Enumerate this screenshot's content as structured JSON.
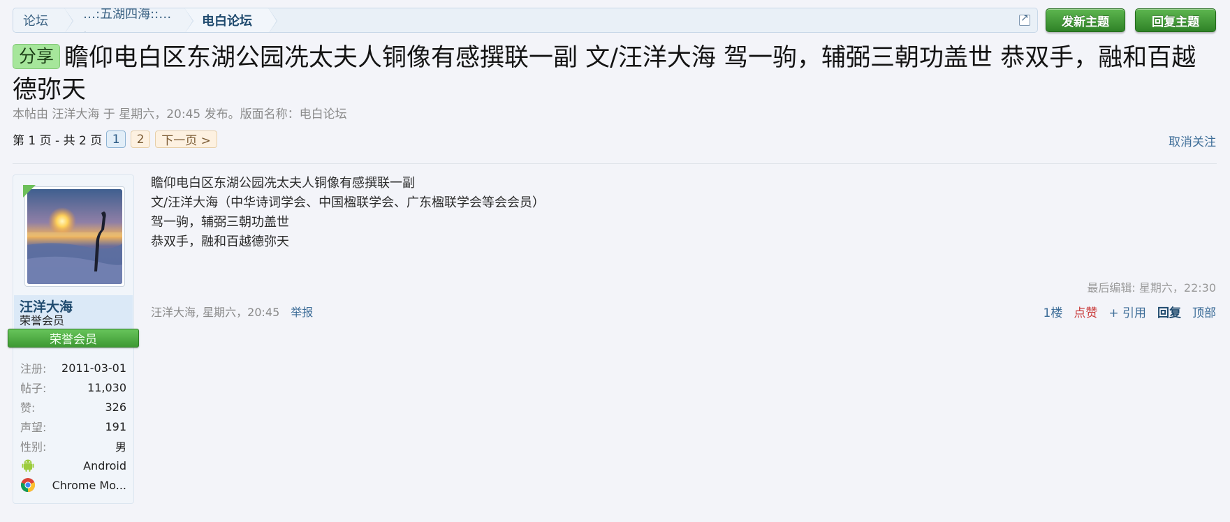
{
  "breadcrumb": {
    "items": [
      "论坛",
      "…:五湖四海::…  .",
      "电白论坛"
    ]
  },
  "buttons": {
    "new_thread": "发新主题",
    "reply_thread": "回复主题"
  },
  "thread": {
    "prefix": "分享",
    "title": "瞻仰电白区东湖公园冼太夫人铜像有感撰联一副 文/汪洋大海 驾一驹，辅弼三朝功盖世 恭双手，融和百越德弥天",
    "meta": "本帖由 汪洋大海 于 星期六，20:45 发布。版面名称：电白论坛"
  },
  "pager": {
    "count_text": "第 1 页 - 共 2 页",
    "pages": [
      "1",
      "2"
    ],
    "next": "下一页 >",
    "unwatch": "取消关注"
  },
  "user": {
    "name": "汪洋大海",
    "title": "荣誉会员",
    "ribbon": "荣誉会员",
    "stats": [
      {
        "label": "注册:",
        "value": "2011-03-01"
      },
      {
        "label": "帖子:",
        "value": "11,030"
      },
      {
        "label": "赞:",
        "value": "326"
      },
      {
        "label": "声望:",
        "value": "191"
      },
      {
        "label": "性别:",
        "value": "男"
      }
    ],
    "os": "Android",
    "browser": "Chrome Mo..."
  },
  "post": {
    "lines": [
      "瞻仰电白区东湖公园冼太夫人铜像有感撰联一副",
      "文/汪洋大海（中华诗词学会、中国楹联学会、广东楹联学会等会会员）",
      "驾一驹，辅弼三朝功盖世",
      "恭双手，融和百越德弥天"
    ],
    "last_edit": "最后编辑: 星期六，22:30",
    "author_time": "汪洋大海, 星期六，20:45",
    "report": "举报",
    "floor": "1楼",
    "like": "点赞",
    "quote": "+ 引用",
    "reply": "回复",
    "top": "顶部"
  },
  "colors": {
    "accent_green": "#3e9933",
    "link_blue": "#3d6d98",
    "like_red": "#c93a3a"
  }
}
